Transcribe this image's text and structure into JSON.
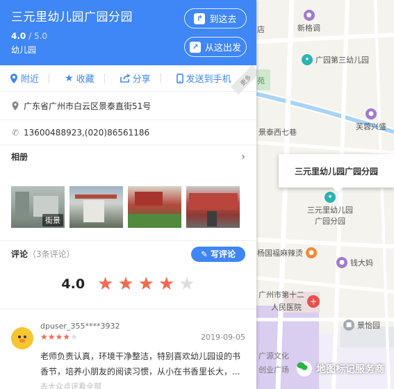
{
  "panel": {
    "title": "三元里幼儿园广园分园",
    "rating": "4.0",
    "rating_denominator": "/ 5.0",
    "category": "幼儿园",
    "route_to_label": "到这去",
    "route_from_label": "从这出发",
    "actions": [
      {
        "label": "附近",
        "icon": "location-pin-icon"
      },
      {
        "label": "收藏",
        "icon": "star-icon"
      },
      {
        "label": "分享",
        "icon": "share-icon"
      },
      {
        "label": "发送到手机",
        "icon": "phone-icon"
      }
    ],
    "corner_more": "更多",
    "address": "广东省广州市白云区景泰直街51号",
    "phone": "13600488923,(020)86561186",
    "photos_title": "相册",
    "street_view_tag": "街景",
    "reviews_title": "评论",
    "reviews_count": "（3条评论）",
    "write_review_label": "写评论",
    "overall_score": "4.0",
    "overall_stars": 4,
    "review": {
      "user": "dpuser_355****3932",
      "stars": 4,
      "date": "2019-09-05",
      "text": "老师负责认真，环境干净整洁，特别喜欢幼儿园设的书香节，培养小朋友的阅读习惯，从小在书香里长大，...",
      "more": "去大众点评看全部"
    }
  },
  "map": {
    "pois": [
      {
        "name": "新格调",
        "color": "purple"
      },
      {
        "name": "广园第三幼儿园",
        "color": "teal"
      },
      {
        "name": "芙蓉兴盛",
        "color": "purple"
      },
      {
        "name": "景泰西七巷",
        "color": "gray"
      },
      {
        "name": "三元里幼儿园",
        "color": "teal"
      },
      {
        "name": "广园分园",
        "color": ""
      },
      {
        "name": "杨国福麻辣烫",
        "color": "orange"
      },
      {
        "name": "钱大妈",
        "color": "purple"
      },
      {
        "name": "广州市第十二",
        "color": "red"
      },
      {
        "name": "人民医院",
        "color": ""
      },
      {
        "name": "景怡园",
        "color": "gray"
      },
      {
        "name": "广源文化",
        "color": ""
      },
      {
        "name": "创业广场",
        "color": ""
      },
      {
        "name": "店",
        "color": ""
      },
      {
        "name": "苑",
        "color": ""
      }
    ],
    "callout": "三元里幼儿园广园分园",
    "watermark": "地图标记服务商"
  },
  "colors": {
    "accent": "#3f86f6",
    "star": "#f4694f"
  }
}
